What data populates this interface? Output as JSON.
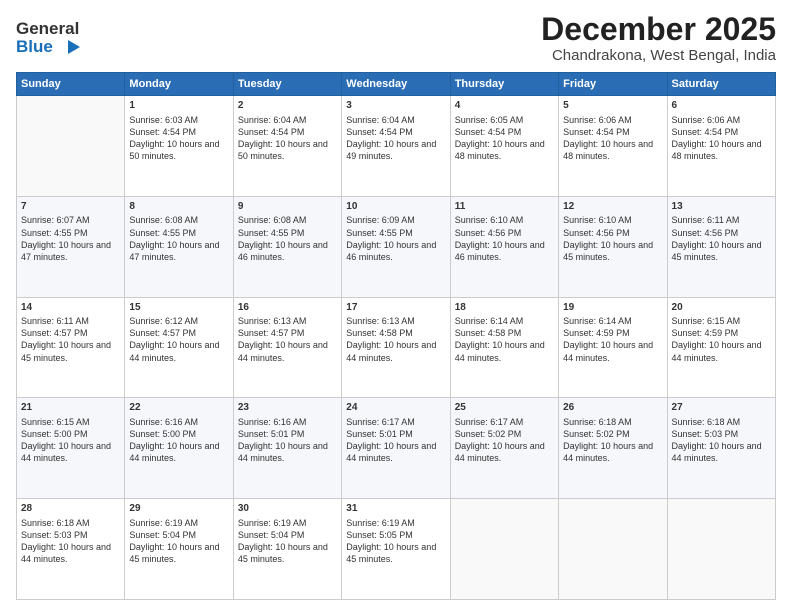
{
  "header": {
    "logo_general": "General",
    "logo_blue": "Blue",
    "month_title": "December 2025",
    "location": "Chandrakona, West Bengal, India"
  },
  "weekdays": [
    "Sunday",
    "Monday",
    "Tuesday",
    "Wednesday",
    "Thursday",
    "Friday",
    "Saturday"
  ],
  "weeks": [
    [
      {
        "day": "",
        "sunrise": "",
        "sunset": "",
        "daylight": ""
      },
      {
        "day": "1",
        "sunrise": "Sunrise: 6:03 AM",
        "sunset": "Sunset: 4:54 PM",
        "daylight": "Daylight: 10 hours and 50 minutes."
      },
      {
        "day": "2",
        "sunrise": "Sunrise: 6:04 AM",
        "sunset": "Sunset: 4:54 PM",
        "daylight": "Daylight: 10 hours and 50 minutes."
      },
      {
        "day": "3",
        "sunrise": "Sunrise: 6:04 AM",
        "sunset": "Sunset: 4:54 PM",
        "daylight": "Daylight: 10 hours and 49 minutes."
      },
      {
        "day": "4",
        "sunrise": "Sunrise: 6:05 AM",
        "sunset": "Sunset: 4:54 PM",
        "daylight": "Daylight: 10 hours and 48 minutes."
      },
      {
        "day": "5",
        "sunrise": "Sunrise: 6:06 AM",
        "sunset": "Sunset: 4:54 PM",
        "daylight": "Daylight: 10 hours and 48 minutes."
      },
      {
        "day": "6",
        "sunrise": "Sunrise: 6:06 AM",
        "sunset": "Sunset: 4:54 PM",
        "daylight": "Daylight: 10 hours and 48 minutes."
      }
    ],
    [
      {
        "day": "7",
        "sunrise": "Sunrise: 6:07 AM",
        "sunset": "Sunset: 4:55 PM",
        "daylight": "Daylight: 10 hours and 47 minutes."
      },
      {
        "day": "8",
        "sunrise": "Sunrise: 6:08 AM",
        "sunset": "Sunset: 4:55 PM",
        "daylight": "Daylight: 10 hours and 47 minutes."
      },
      {
        "day": "9",
        "sunrise": "Sunrise: 6:08 AM",
        "sunset": "Sunset: 4:55 PM",
        "daylight": "Daylight: 10 hours and 46 minutes."
      },
      {
        "day": "10",
        "sunrise": "Sunrise: 6:09 AM",
        "sunset": "Sunset: 4:55 PM",
        "daylight": "Daylight: 10 hours and 46 minutes."
      },
      {
        "day": "11",
        "sunrise": "Sunrise: 6:10 AM",
        "sunset": "Sunset: 4:56 PM",
        "daylight": "Daylight: 10 hours and 46 minutes."
      },
      {
        "day": "12",
        "sunrise": "Sunrise: 6:10 AM",
        "sunset": "Sunset: 4:56 PM",
        "daylight": "Daylight: 10 hours and 45 minutes."
      },
      {
        "day": "13",
        "sunrise": "Sunrise: 6:11 AM",
        "sunset": "Sunset: 4:56 PM",
        "daylight": "Daylight: 10 hours and 45 minutes."
      }
    ],
    [
      {
        "day": "14",
        "sunrise": "Sunrise: 6:11 AM",
        "sunset": "Sunset: 4:57 PM",
        "daylight": "Daylight: 10 hours and 45 minutes."
      },
      {
        "day": "15",
        "sunrise": "Sunrise: 6:12 AM",
        "sunset": "Sunset: 4:57 PM",
        "daylight": "Daylight: 10 hours and 44 minutes."
      },
      {
        "day": "16",
        "sunrise": "Sunrise: 6:13 AM",
        "sunset": "Sunset: 4:57 PM",
        "daylight": "Daylight: 10 hours and 44 minutes."
      },
      {
        "day": "17",
        "sunrise": "Sunrise: 6:13 AM",
        "sunset": "Sunset: 4:58 PM",
        "daylight": "Daylight: 10 hours and 44 minutes."
      },
      {
        "day": "18",
        "sunrise": "Sunrise: 6:14 AM",
        "sunset": "Sunset: 4:58 PM",
        "daylight": "Daylight: 10 hours and 44 minutes."
      },
      {
        "day": "19",
        "sunrise": "Sunrise: 6:14 AM",
        "sunset": "Sunset: 4:59 PM",
        "daylight": "Daylight: 10 hours and 44 minutes."
      },
      {
        "day": "20",
        "sunrise": "Sunrise: 6:15 AM",
        "sunset": "Sunset: 4:59 PM",
        "daylight": "Daylight: 10 hours and 44 minutes."
      }
    ],
    [
      {
        "day": "21",
        "sunrise": "Sunrise: 6:15 AM",
        "sunset": "Sunset: 5:00 PM",
        "daylight": "Daylight: 10 hours and 44 minutes."
      },
      {
        "day": "22",
        "sunrise": "Sunrise: 6:16 AM",
        "sunset": "Sunset: 5:00 PM",
        "daylight": "Daylight: 10 hours and 44 minutes."
      },
      {
        "day": "23",
        "sunrise": "Sunrise: 6:16 AM",
        "sunset": "Sunset: 5:01 PM",
        "daylight": "Daylight: 10 hours and 44 minutes."
      },
      {
        "day": "24",
        "sunrise": "Sunrise: 6:17 AM",
        "sunset": "Sunset: 5:01 PM",
        "daylight": "Daylight: 10 hours and 44 minutes."
      },
      {
        "day": "25",
        "sunrise": "Sunrise: 6:17 AM",
        "sunset": "Sunset: 5:02 PM",
        "daylight": "Daylight: 10 hours and 44 minutes."
      },
      {
        "day": "26",
        "sunrise": "Sunrise: 6:18 AM",
        "sunset": "Sunset: 5:02 PM",
        "daylight": "Daylight: 10 hours and 44 minutes."
      },
      {
        "day": "27",
        "sunrise": "Sunrise: 6:18 AM",
        "sunset": "Sunset: 5:03 PM",
        "daylight": "Daylight: 10 hours and 44 minutes."
      }
    ],
    [
      {
        "day": "28",
        "sunrise": "Sunrise: 6:18 AM",
        "sunset": "Sunset: 5:03 PM",
        "daylight": "Daylight: 10 hours and 44 minutes."
      },
      {
        "day": "29",
        "sunrise": "Sunrise: 6:19 AM",
        "sunset": "Sunset: 5:04 PM",
        "daylight": "Daylight: 10 hours and 45 minutes."
      },
      {
        "day": "30",
        "sunrise": "Sunrise: 6:19 AM",
        "sunset": "Sunset: 5:04 PM",
        "daylight": "Daylight: 10 hours and 45 minutes."
      },
      {
        "day": "31",
        "sunrise": "Sunrise: 6:19 AM",
        "sunset": "Sunset: 5:05 PM",
        "daylight": "Daylight: 10 hours and 45 minutes."
      },
      {
        "day": "",
        "sunrise": "",
        "sunset": "",
        "daylight": ""
      },
      {
        "day": "",
        "sunrise": "",
        "sunset": "",
        "daylight": ""
      },
      {
        "day": "",
        "sunrise": "",
        "sunset": "",
        "daylight": ""
      }
    ]
  ]
}
